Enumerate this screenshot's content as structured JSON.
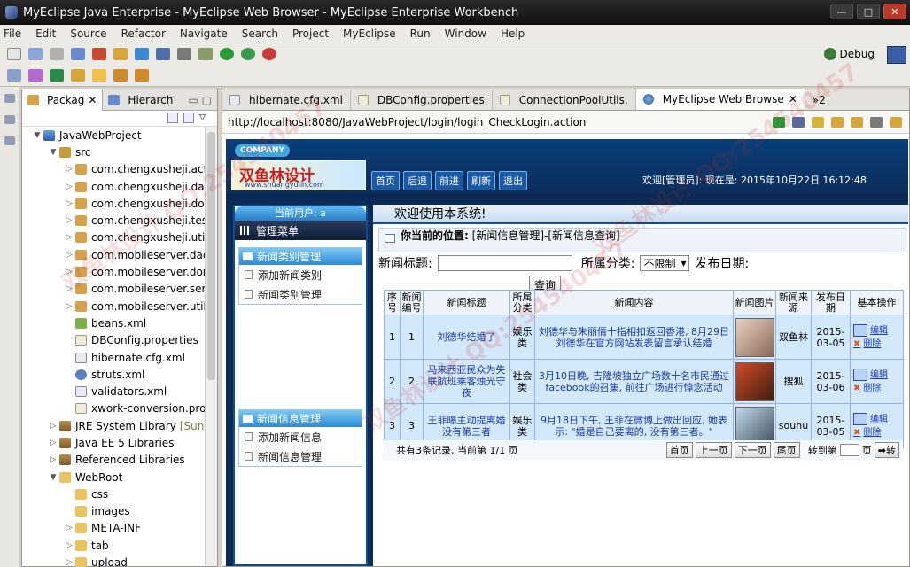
{
  "window": {
    "title": "MyEclipse Java Enterprise - MyEclipse Web Browser - MyEclipse Enterprise Workbench"
  },
  "menu": [
    "File",
    "Edit",
    "Source",
    "Refactor",
    "Navigate",
    "Search",
    "Project",
    "MyEclipse",
    "Run",
    "Window",
    "Help"
  ],
  "toolbar": {
    "debug_label": "Debug"
  },
  "explorer": {
    "tab_package": "Packag",
    "tab_hierarchy": "Hierarch",
    "tree": [
      {
        "label": "JavaWebProject",
        "icon": "project-icon",
        "depth": 0,
        "twisty": "▼"
      },
      {
        "label": "src",
        "icon": "source-folder-icon",
        "depth": 1,
        "twisty": "▼"
      },
      {
        "label": "com.chengxusheji.actic",
        "icon": "package-icon",
        "depth": 2,
        "twisty": "▷"
      },
      {
        "label": "com.chengxusheji.dao",
        "icon": "package-icon",
        "depth": 2,
        "twisty": "▷"
      },
      {
        "label": "com.chengxusheji.don",
        "icon": "package-icon",
        "depth": 2,
        "twisty": "▷"
      },
      {
        "label": "com.chengxusheji.test",
        "icon": "package-icon",
        "depth": 2,
        "twisty": "▷"
      },
      {
        "label": "com.chengxusheji.utils",
        "icon": "package-icon",
        "depth": 2,
        "twisty": "▷"
      },
      {
        "label": "com.mobileserver.dac",
        "icon": "package-icon",
        "depth": 2,
        "twisty": "▷"
      },
      {
        "label": "com.mobileserver.dor",
        "icon": "package-icon",
        "depth": 2,
        "twisty": "▷"
      },
      {
        "label": "com.mobileserver.serv",
        "icon": "package-icon",
        "depth": 2,
        "twisty": "▷"
      },
      {
        "label": "com.mobileserver.util",
        "icon": "package-icon",
        "depth": 2,
        "twisty": "▷"
      },
      {
        "label": "beans.xml",
        "icon": "bean-icon",
        "depth": 2,
        "twisty": ""
      },
      {
        "label": "DBConfig.properties",
        "icon": "properties-file-icon",
        "depth": 2,
        "twisty": ""
      },
      {
        "label": "hibernate.cfg.xml",
        "icon": "hibernate-icon",
        "depth": 2,
        "twisty": ""
      },
      {
        "label": "struts.xml",
        "icon": "gear-icon",
        "depth": 2,
        "twisty": ""
      },
      {
        "label": "validators.xml",
        "icon": "xml-file-icon",
        "depth": 2,
        "twisty": ""
      },
      {
        "label": "xwork-conversion.pro",
        "icon": "properties-file-icon",
        "depth": 2,
        "twisty": ""
      },
      {
        "label": "JRE System Library",
        "suffix": "[Sun J",
        "icon": "library-icon",
        "depth": 1,
        "twisty": "▷"
      },
      {
        "label": "Java EE 5 Libraries",
        "icon": "library-icon",
        "depth": 1,
        "twisty": "▷"
      },
      {
        "label": "Referenced Libraries",
        "icon": "library-icon",
        "depth": 1,
        "twisty": "▷"
      },
      {
        "label": "WebRoot",
        "icon": "folder-icon",
        "depth": 1,
        "twisty": "▼"
      },
      {
        "label": "css",
        "icon": "folder-icon",
        "depth": 2,
        "twisty": ""
      },
      {
        "label": "images",
        "icon": "folder-icon",
        "depth": 2,
        "twisty": ""
      },
      {
        "label": "META-INF",
        "icon": "folder-icon",
        "depth": 2,
        "twisty": "▷"
      },
      {
        "label": "tab",
        "icon": "folder-icon",
        "depth": 2,
        "twisty": "▷"
      },
      {
        "label": "upload",
        "icon": "folder-icon",
        "depth": 2,
        "twisty": "▷"
      }
    ]
  },
  "editor": {
    "tabs": [
      {
        "label": "hibernate.cfg.xml",
        "active": false
      },
      {
        "label": "DBConfig.properties",
        "active": false
      },
      {
        "label": "ConnectionPoolUtils.",
        "active": false
      },
      {
        "label": "MyEclipse Web Browse",
        "active": true
      },
      {
        "label": "»2",
        "active": false
      }
    ],
    "url": "http://localhost:8080/JavaWebProject/login/login_CheckLogin.action"
  },
  "site": {
    "company": "COMPANY",
    "logo_text": "双鱼林设计",
    "logo_url": "www.shuangyulin.com",
    "nav": [
      "首页",
      "后退",
      "前进",
      "刷新",
      "退出"
    ],
    "welcome": "欢迎[管理员]:   现在是: 2015年10月22日  16:12:48",
    "current_user": "当前用户: a",
    "admin_menu": "管理菜单",
    "menu_groups": [
      {
        "title": "新闻类别管理",
        "items": [
          "添加新闻类别",
          "新闻类别管理"
        ]
      },
      {
        "title": "新闻信息管理",
        "items": [
          "添加新闻信息",
          "新闻信息管理"
        ]
      }
    ],
    "welcome_system": "欢迎使用本系统!",
    "location_label": "你当前的位置:",
    "location_value": "[新闻信息管理]-[新闻信息查询]",
    "search": {
      "title_label": "新闻标题:",
      "category_label": "所属分类:",
      "category_value": "不限制",
      "date_label": "发布日期:",
      "button": "查询"
    },
    "table": {
      "headers": [
        "序号",
        "新闻编号",
        "新闻标题",
        "所属分类",
        "新闻内容",
        "新闻图片",
        "新闻来源",
        "发布日期",
        "基本操作"
      ],
      "rows": [
        {
          "seq": "1",
          "id": "1",
          "title": "刘德华结婚了",
          "category": "娱乐类",
          "content": "刘德华与朱丽倩十指相扣返回香港, 8月29日刘德华在官方网站发表留言承认结婚",
          "source": "双鱼林",
          "date": "2015-03-05",
          "edit": "编辑",
          "delete": "删除"
        },
        {
          "seq": "2",
          "id": "2",
          "title": "马来西亚民众为失联航班乘客烛光守夜",
          "category": "社会类",
          "content": "3月10日晚, 吉隆坡独立广场数十名市民通过facebook的召集, 前往广场进行悼念活动",
          "source": "搜狐",
          "date": "2015-03-06",
          "edit": "编辑",
          "delete": "删除"
        },
        {
          "seq": "3",
          "id": "3",
          "title": "王菲曝主动提离婚 没有第三者",
          "category": "娱乐类",
          "content": "9月18日下午, 王菲在微博上做出回应, 她表示: \"婚是自己要离的, 没有第三者。\"",
          "source": "souhu",
          "date": "2015-03-05",
          "edit": "编辑",
          "delete": "删除"
        }
      ]
    },
    "pager": {
      "info": "共有3条记录, 当前第 1/1 页",
      "first": "首页",
      "prev": "上一页",
      "next": "下一页",
      "last": "尾页",
      "goto": "转到第",
      "page_unit": "页",
      "go": "➡转"
    }
  }
}
